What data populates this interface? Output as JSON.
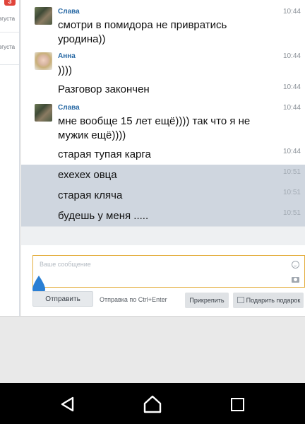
{
  "sidebar": {
    "badge": "3",
    "items": [
      {
        "date": "вгуста"
      },
      {
        "date": "вгуста"
      }
    ]
  },
  "messages": [
    {
      "author": "Слава",
      "time": "10:44",
      "text": "смотри в помидора не привратись уродина))"
    },
    {
      "author": "Анна",
      "time": "10:44",
      "text": "))))"
    },
    {
      "time": "10:44",
      "text": "Разговор закончен"
    },
    {
      "author": "Слава",
      "time": "10:44",
      "text": "мне вообще 15 лет ещё)))) так что я не мужик ещё))))"
    },
    {
      "time": "10:44",
      "text": "старая тупая карга"
    },
    {
      "time": "10:51",
      "text": "ехехех овца",
      "selected": true
    },
    {
      "time": "10:51",
      "text": "старая кляча",
      "selected": true
    },
    {
      "time": "10:51",
      "text": "будешь у меня .....",
      "selected": true
    }
  ],
  "compose": {
    "placeholder": "Ваше сообщение",
    "accent_color": "#e3ad3c",
    "drop_color": "#2a7fd4"
  },
  "actions": {
    "send_label": "Отправить",
    "hint": "Отправка по Ctrl+Enter",
    "attach_label": "Прикрепить",
    "gift_label": "Подарить подарок"
  },
  "icons": [
    "smile-icon",
    "camera-icon",
    "gift-icon",
    "back-icon",
    "home-icon",
    "recent-apps-icon"
  ],
  "colors": {
    "author": "#2a6aa5",
    "selected_row": "#cfd6df",
    "badge": "#e0443a"
  }
}
